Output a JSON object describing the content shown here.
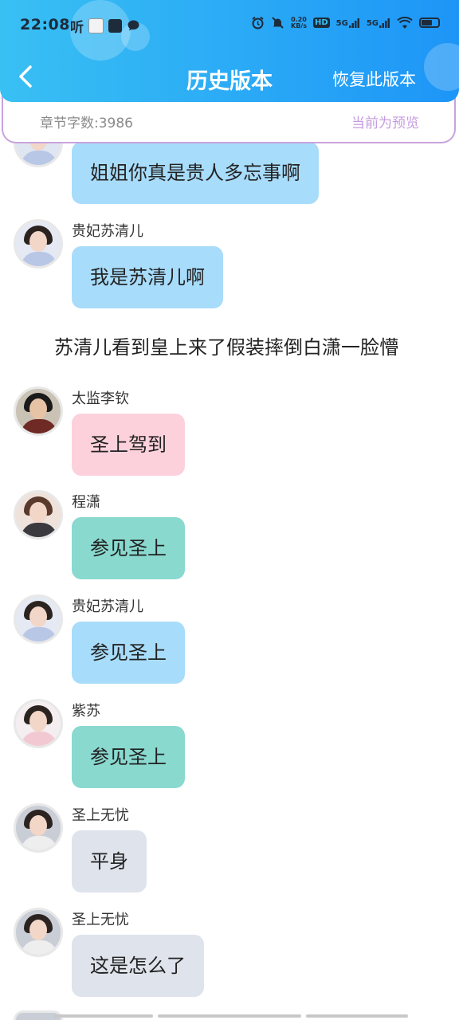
{
  "status_bar": {
    "time": "22:08",
    "ting": "听",
    "net_speed_value": "0.20",
    "net_speed_unit": "KB/s",
    "hd": "HD",
    "sim1": "5G",
    "sim2": "5G"
  },
  "header": {
    "title": "历史版本",
    "restore_label": "恢复此版本",
    "back_icon": "chevron-left-icon",
    "background": "#2aa9f6"
  },
  "info": {
    "word_count": "章节字数:3986",
    "preview_status": "当前为预览"
  },
  "messages": [
    {
      "sender": "",
      "text": "姐姐你真是贵人多忘事啊",
      "color": "#a8dcfb"
    },
    {
      "sender": "贵妃苏清儿",
      "text": "我是苏清儿啊",
      "color": "#a8dcfb"
    },
    {
      "narration": "苏清儿看到皇上来了假装摔倒白潇一脸懵"
    },
    {
      "sender": "太监李钦",
      "text": "圣上驾到",
      "color": "#fdd1dc"
    },
    {
      "sender": "程潇",
      "text": "参见圣上",
      "color": "#89d9cf"
    },
    {
      "sender": "贵妃苏清儿",
      "text": "参见圣上",
      "color": "#a8dcfb"
    },
    {
      "sender": "紫苏",
      "text": "参见圣上",
      "color": "#89d9cf"
    },
    {
      "sender": "圣上无忧",
      "text": "平身",
      "color": "#dfe3ec"
    },
    {
      "sender": "圣上无忧",
      "text": "这是怎么了",
      "color": "#dfe3ec"
    }
  ]
}
